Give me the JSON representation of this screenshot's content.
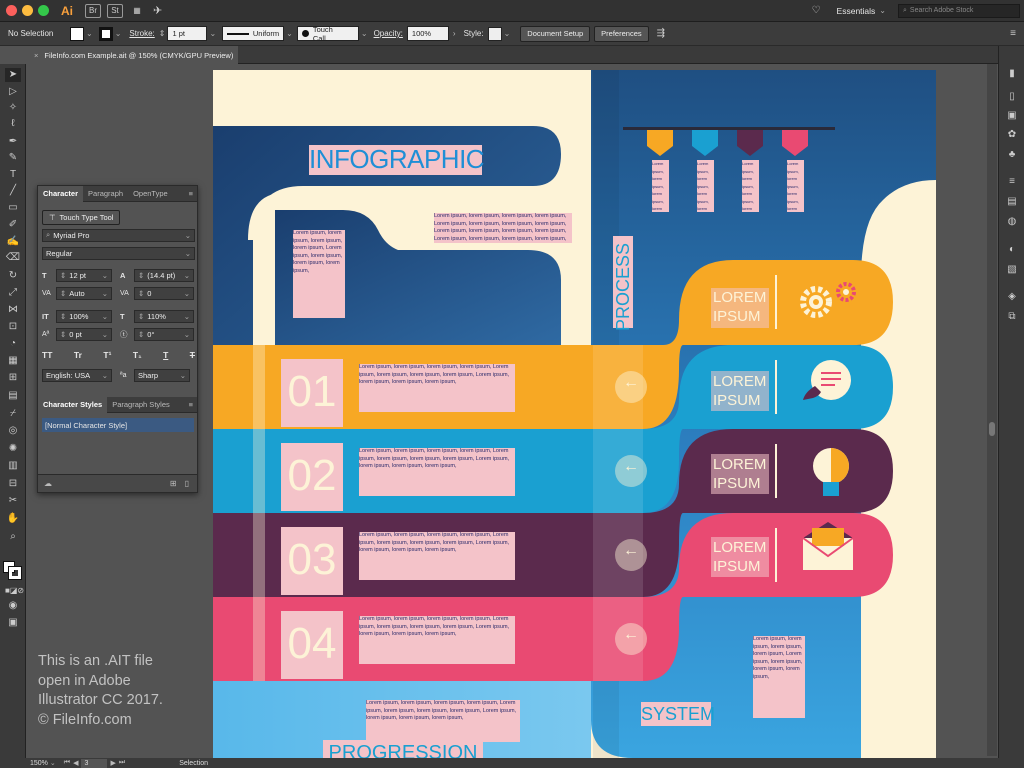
{
  "menubar": {
    "app_icon": "Ai",
    "bridge": "Br",
    "stock": "St",
    "workspace": "Essentials",
    "search_placeholder": "Search Adobe Stock"
  },
  "control_bar": {
    "selection": "No Selection",
    "stroke_label": "Stroke:",
    "stroke_value": "1 pt",
    "profile": "Uniform",
    "brush": "Touch Call...",
    "opacity_label": "Opacity:",
    "opacity_value": "100%",
    "style_label": "Style:",
    "doc_setup": "Document Setup",
    "preferences": "Preferences"
  },
  "document": {
    "tab_title": "FileInfo.com Example.ait @ 150% (CMYK/GPU Preview)"
  },
  "character_panel": {
    "tabs": [
      "Character",
      "Paragraph",
      "OpenType"
    ],
    "touch_type": "Touch Type Tool",
    "font": "Myriad Pro",
    "style": "Regular",
    "size": "12 pt",
    "leading": "(14.4 pt)",
    "kerning": "Auto",
    "tracking": "0",
    "vscale": "100%",
    "hscale": "110%",
    "baseline": "0 pt",
    "rotation": "0°",
    "language": "English: USA",
    "aa_label": "a",
    "antialias": "Sharp",
    "styles_tabs": [
      "Character Styles",
      "Paragraph Styles"
    ],
    "style_item": "[Normal Character Style]"
  },
  "artwork": {
    "title": "INFOGRAPHIC",
    "process": "PROCESS",
    "system": "SYSTEM",
    "progression": "PROGRESSION",
    "numbers": [
      "01",
      "02",
      "03",
      "04"
    ],
    "lorem_label": "LOREM IPSUM",
    "lorem_text": "Lorem ipsum, lorem ipsum, lorem ipsum, lorem ipsum,",
    "arrow": "←",
    "colors": {
      "orange": "#f7a824",
      "blue": "#1aa0d1",
      "purple": "#5b2a4d",
      "pink": "#e94a72",
      "navy": "#1c4c7c",
      "cream": "#fdf3d7",
      "label_pink": "#f4c3c9"
    }
  },
  "watermark": {
    "line1": "This is an .AIT file",
    "line2": "open in Adobe",
    "line3": "Illustrator CC 2017.",
    "line4": "© FileInfo.com"
  },
  "status": {
    "zoom": "150%",
    "page": "3",
    "tool": "Selection"
  }
}
